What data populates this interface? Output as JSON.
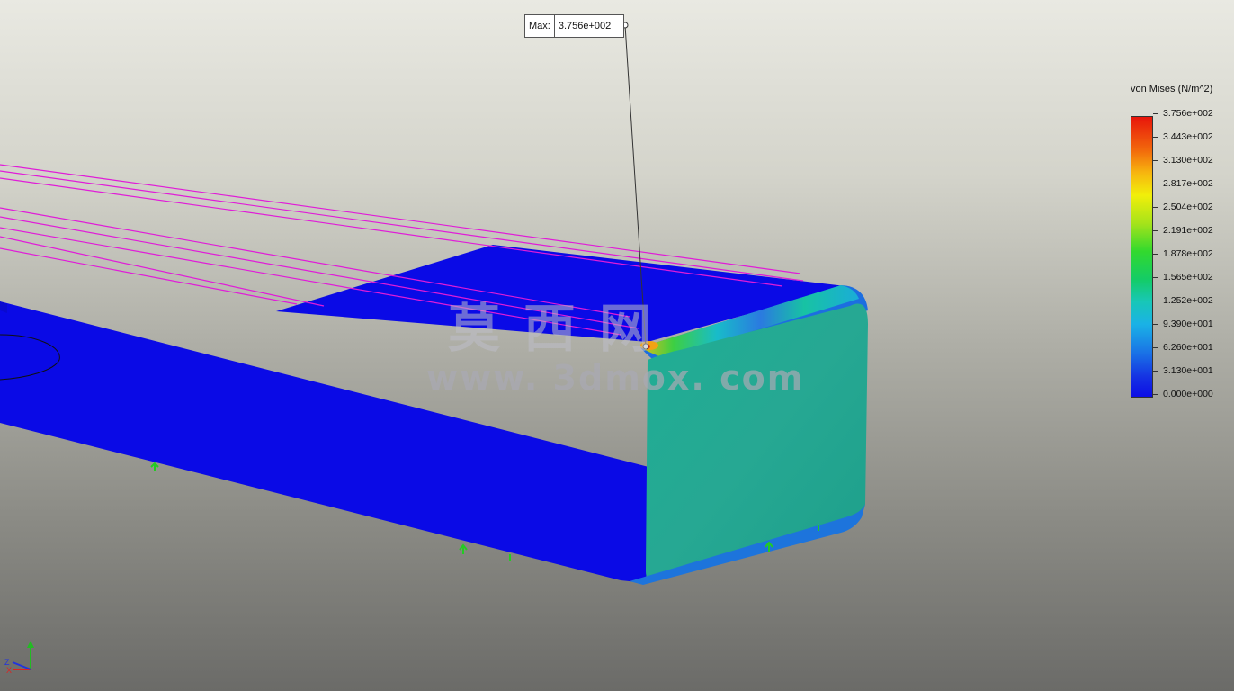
{
  "probe": {
    "label": "Max:",
    "value": "3.756e+002"
  },
  "legend": {
    "title": "von Mises (N/m^2)",
    "ticks": [
      "3.756e+002",
      "3.443e+002",
      "3.130e+002",
      "2.817e+002",
      "2.504e+002",
      "2.191e+002",
      "1.878e+002",
      "1.565e+002",
      "1.252e+002",
      "9.390e+001",
      "6.260e+001",
      "3.130e+001",
      "0.000e+000"
    ]
  },
  "watermark": {
    "chinese": "莫西网",
    "url": "www. 3dmox. com"
  },
  "triad": {
    "x": "X",
    "y": "Y",
    "z": "Z"
  }
}
